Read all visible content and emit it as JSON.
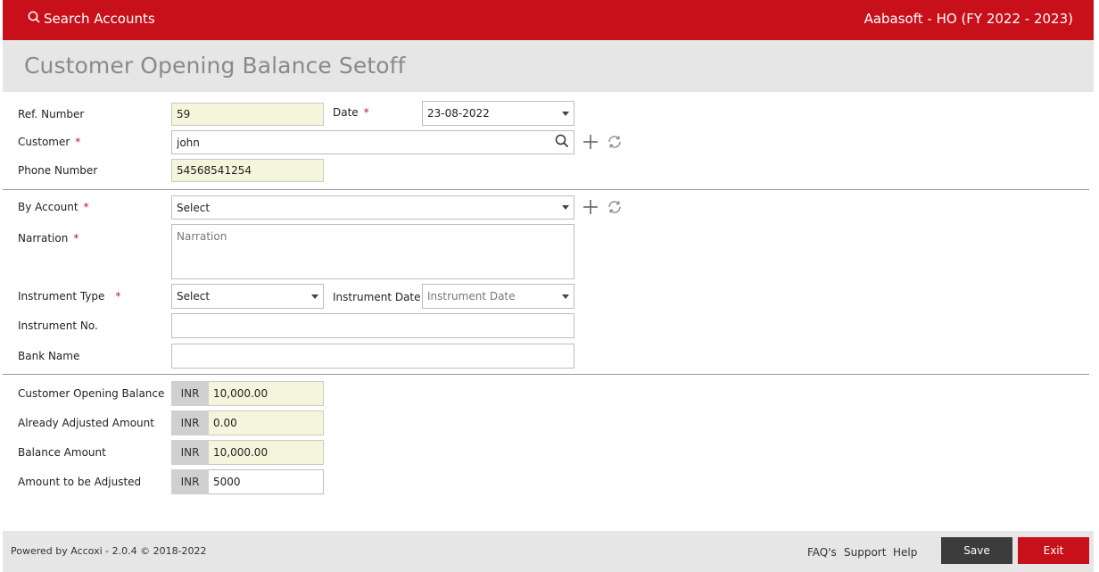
{
  "header": {
    "search_label": "Search Accounts",
    "company": "Aabasoft - HO (FY 2022 - 2023)",
    "brand_color": "#c8101a"
  },
  "page": {
    "title": "Customer Opening Balance Setoff"
  },
  "form": {
    "ref_number": {
      "label": "Ref. Number",
      "value": "59"
    },
    "date": {
      "label": "Date",
      "required": "*",
      "value": "23-08-2022"
    },
    "customer": {
      "label": "Customer",
      "required": "*",
      "value": "john"
    },
    "phone": {
      "label": "Phone Number",
      "value": "54568541254"
    },
    "by_account": {
      "label": "By Account",
      "required": "*",
      "value": "Select"
    },
    "narration": {
      "label": "Narration",
      "required": "*",
      "placeholder": "Narration"
    },
    "instrument_type": {
      "label": "Instrument Type",
      "required": "*",
      "value": "Select"
    },
    "instrument_date": {
      "label": "Instrument Date",
      "placeholder": "Instrument Date"
    },
    "instrument_no": {
      "label": "Instrument No.",
      "value": ""
    },
    "bank_name": {
      "label": "Bank Name",
      "value": ""
    }
  },
  "balances": {
    "currency": "INR",
    "customer_opening": {
      "label": "Customer Opening Balance",
      "value": "10,000.00"
    },
    "already_adjusted": {
      "label": "Already Adjusted Amount",
      "value": "0.00"
    },
    "balance_amount": {
      "label": "Balance Amount",
      "value": "10,000.00"
    },
    "to_adjust": {
      "label": "Amount to be Adjusted",
      "value": "5000"
    }
  },
  "footer": {
    "powered_by": "Powered by Accoxi - 2.0.4 © 2018-2022",
    "faq": "FAQ's",
    "support": "Support",
    "help": "Help",
    "save": "Save",
    "exit": "Exit"
  }
}
